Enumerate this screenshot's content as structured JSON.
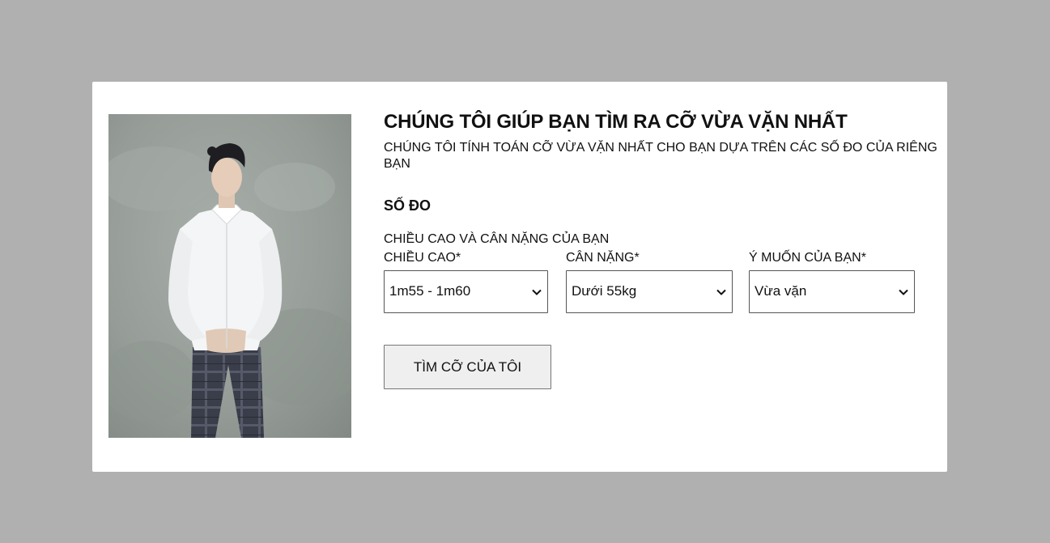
{
  "modal": {
    "image_alt": "Nam mẫu mặc áo sơ mi trắng",
    "title": "CHÚNG TÔI GIÚP BẠN TÌM RA CỠ VỪA VẶN NHẤT",
    "subtitle": "CHÚNG TÔI TÍNH TOÁN CỠ VỪA VẶN NHẤT CHO BẠN DỰA TRÊN CÁC SỐ ĐO CỦA RIÊNG BẠN",
    "section_title": "SỐ ĐO",
    "section_desc": "CHIỀU CAO VÀ CÂN NẶNG CỦA BẠN",
    "fields": [
      {
        "label": "CHIỀU CAO*",
        "value": "1m55 - 1m60"
      },
      {
        "label": "CÂN NẶNG*",
        "value": "Dưới 55kg"
      },
      {
        "label": "Ý MUỐN CỦA BẠN*",
        "value": "Vừa vặn"
      }
    ],
    "submit_label": "TÌM CỠ CỦA TÔI"
  },
  "colors": {
    "overlay": "#b0b0b0",
    "modal_bg": "#ffffff",
    "button_bg": "#efefef"
  }
}
